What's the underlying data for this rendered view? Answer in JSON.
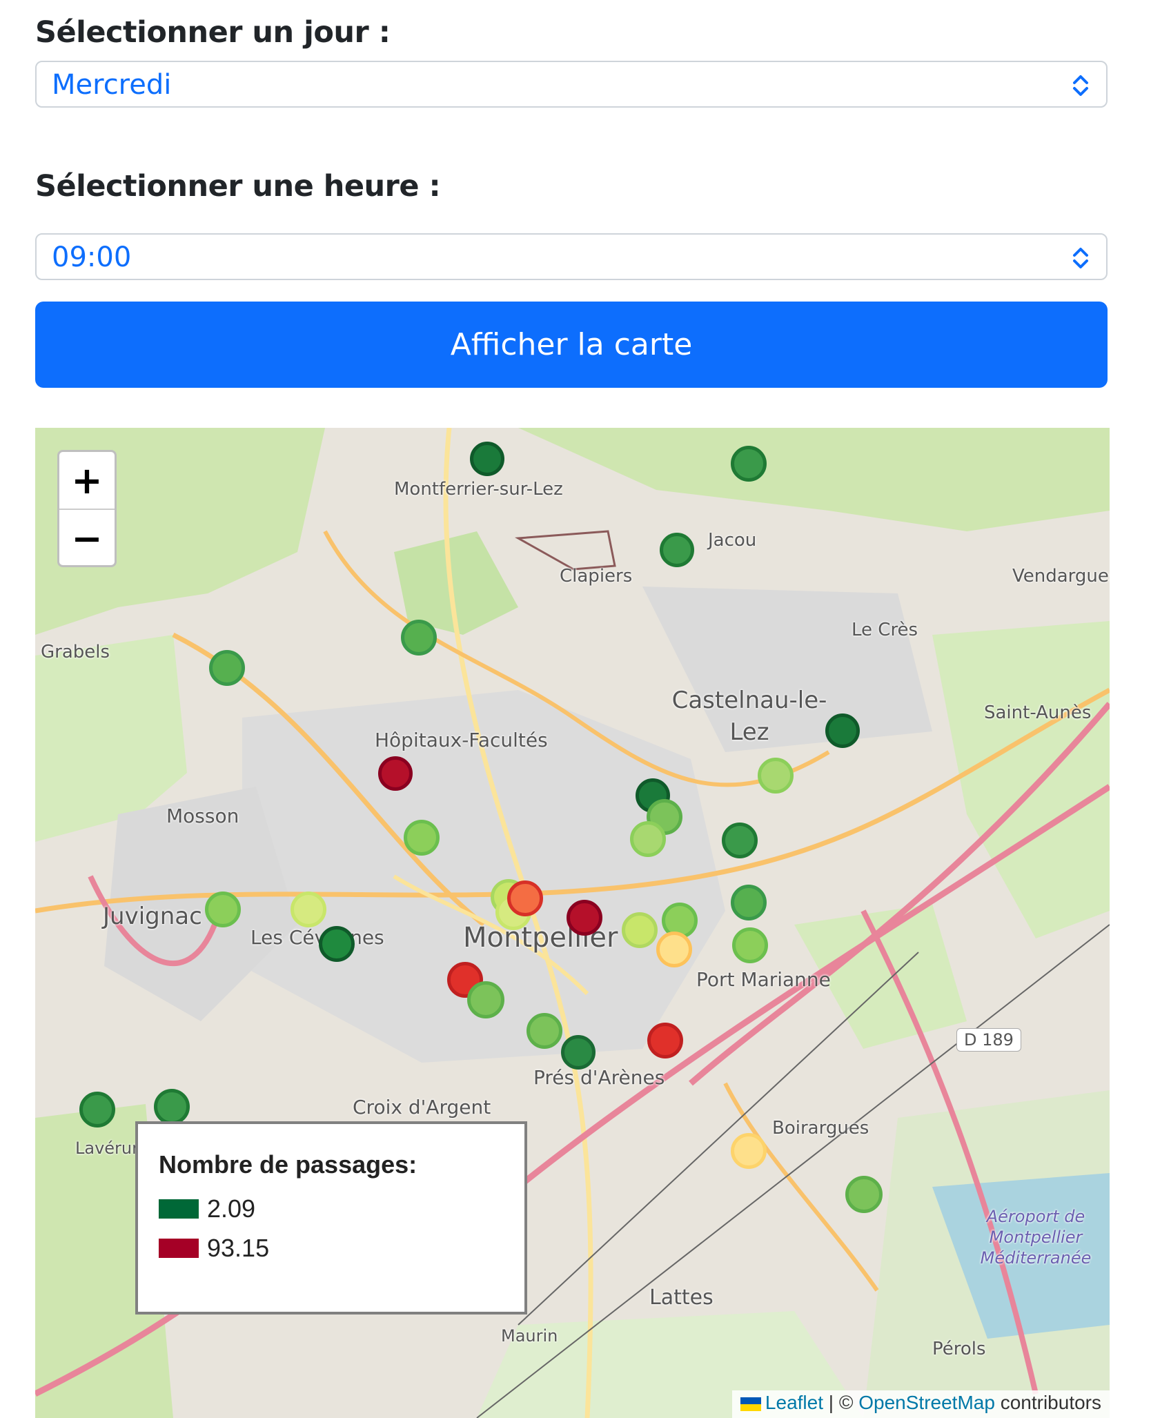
{
  "form": {
    "day_label": "Sélectionner un jour :",
    "day_value": "Mercredi",
    "hour_label": "Sélectionner une heure :",
    "hour_value": "09:00",
    "submit_label": "Afficher la carte"
  },
  "map": {
    "zoom_in": "+",
    "zoom_out": "−",
    "legend": {
      "title": "Nombre de passages:",
      "items": [
        {
          "value": "2.09",
          "color": "#006837"
        },
        {
          "value": "93.15",
          "color": "#a50026"
        }
      ]
    },
    "attribution": {
      "leaflet": "Leaflet",
      "sep": " | © ",
      "osm": "OpenStreetMap",
      "contributors": " contributors"
    },
    "places": [
      "Montferrier-sur-Lez",
      "Jacou",
      "Clapiers",
      "Vendargues",
      "Le Crès",
      "Grabels",
      "Castelnau-le-Lez",
      "Saint-Aunès",
      "Hôpitaux-Facultés",
      "Mosson",
      "Juvignac",
      "Les Cévennes",
      "Montpellier",
      "Port Marianne",
      "D 189",
      "Prés d'Arènes",
      "Croix d'Argent",
      "Boirargues",
      "Lavérune",
      "Aéroport de Montpellier Méditerranée",
      "Lattes",
      "Maurin",
      "Pérols"
    ],
    "marker_colors": {
      "dark_green": "#1a7a3a",
      "green": "#3aa04a",
      "light_green": "#8ccf5a",
      "yellow_green": "#c8e66a",
      "yellow": "#fee08b",
      "orange": "#f46d43",
      "red": "#d73027",
      "dark_red": "#a50026"
    }
  }
}
